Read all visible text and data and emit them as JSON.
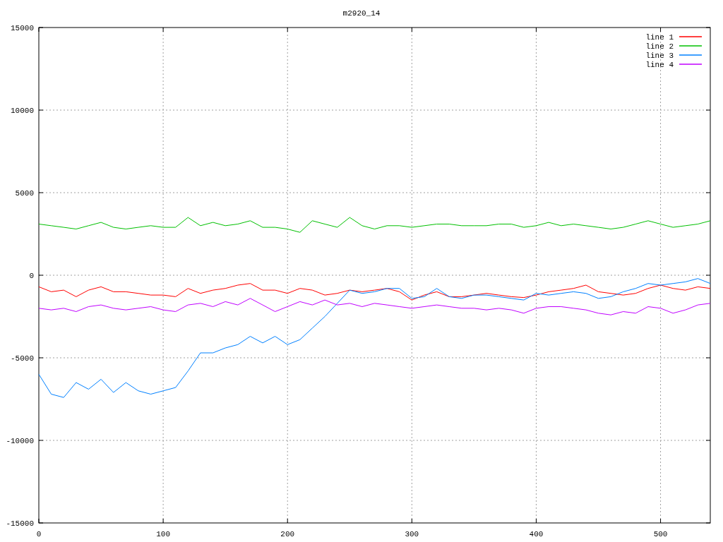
{
  "chart_data": {
    "type": "line",
    "title": "m2920_14",
    "grid": true,
    "legend": true,
    "xlim": [
      0,
      540
    ],
    "ylim": [
      -15000,
      15000
    ],
    "xticks": [
      0,
      100,
      200,
      300,
      400,
      500
    ],
    "yticks": [
      -15000,
      -10000,
      -5000,
      0,
      5000,
      10000,
      15000
    ],
    "x": [
      0,
      10,
      20,
      30,
      40,
      50,
      60,
      70,
      80,
      90,
      100,
      110,
      120,
      130,
      140,
      150,
      160,
      170,
      180,
      190,
      200,
      210,
      220,
      230,
      240,
      250,
      260,
      270,
      280,
      290,
      300,
      310,
      320,
      330,
      340,
      350,
      360,
      370,
      380,
      390,
      400,
      410,
      420,
      430,
      440,
      450,
      460,
      470,
      480,
      490,
      500,
      510,
      520,
      530,
      540
    ],
    "series": [
      {
        "name": "line 1",
        "color": "#ff0000",
        "values": [
          -700,
          -1000,
          -900,
          -1300,
          -900,
          -700,
          -1000,
          -1000,
          -1100,
          -1200,
          -1200,
          -1300,
          -800,
          -1100,
          -900,
          -800,
          -600,
          -500,
          -900,
          -900,
          -1100,
          -800,
          -900,
          -1200,
          -1100,
          -900,
          -1000,
          -900,
          -800,
          -1000,
          -1500,
          -1200,
          -1000,
          -1300,
          -1300,
          -1200,
          -1100,
          -1200,
          -1300,
          -1350,
          -1200,
          -1000,
          -900,
          -800,
          -600,
          -1000,
          -1100,
          -1200,
          -1100,
          -800,
          -600,
          -800,
          -900,
          -700,
          -800
        ]
      },
      {
        "name": "line 2",
        "color": "#00c000",
        "values": [
          3100,
          3000,
          2900,
          2800,
          3000,
          3200,
          2900,
          2800,
          2900,
          3000,
          2900,
          2900,
          3500,
          3000,
          3200,
          3000,
          3100,
          3300,
          2900,
          2900,
          2800,
          2600,
          3300,
          3100,
          2900,
          3500,
          3000,
          2800,
          3000,
          3000,
          2900,
          3000,
          3100,
          3100,
          3000,
          3000,
          3000,
          3100,
          3100,
          2900,
          3000,
          3200,
          3000,
          3100,
          3000,
          2900,
          2800,
          2900,
          3100,
          3300,
          3100,
          2900,
          3000,
          3100,
          3300
        ]
      },
      {
        "name": "line 3",
        "color": "#0080ff",
        "values": [
          -6000,
          -7200,
          -7400,
          -6500,
          -6900,
          -6300,
          -7100,
          -6500,
          -7000,
          -7200,
          -7000,
          -6800,
          -5800,
          -4700,
          -4700,
          -4400,
          -4200,
          -3700,
          -4100,
          -3700,
          -4200,
          -3900,
          -3200,
          -2500,
          -1700,
          -900,
          -1100,
          -1000,
          -800,
          -800,
          -1400,
          -1300,
          -800,
          -1300,
          -1400,
          -1200,
          -1200,
          -1300,
          -1400,
          -1500,
          -1100,
          -1200,
          -1100,
          -1000,
          -1100,
          -1400,
          -1300,
          -1000,
          -800,
          -500,
          -600,
          -500,
          -400,
          -200,
          -500
        ]
      },
      {
        "name": "line 4",
        "color": "#c000ff",
        "values": [
          -2000,
          -2100,
          -2000,
          -2200,
          -1900,
          -1800,
          -2000,
          -2100,
          -2000,
          -1900,
          -2100,
          -2200,
          -1800,
          -1700,
          -1900,
          -1600,
          -1800,
          -1400,
          -1800,
          -2200,
          -1900,
          -1600,
          -1800,
          -1500,
          -1800,
          -1700,
          -1900,
          -1700,
          -1800,
          -1900,
          -2000,
          -1900,
          -1800,
          -1900,
          -2000,
          -2000,
          -2100,
          -2000,
          -2100,
          -2300,
          -2000,
          -1900,
          -1900,
          -2000,
          -2100,
          -2300,
          -2400,
          -2200,
          -2300,
          -1900,
          -2000,
          -2300,
          -2100,
          -1800,
          -1700
        ]
      }
    ]
  }
}
